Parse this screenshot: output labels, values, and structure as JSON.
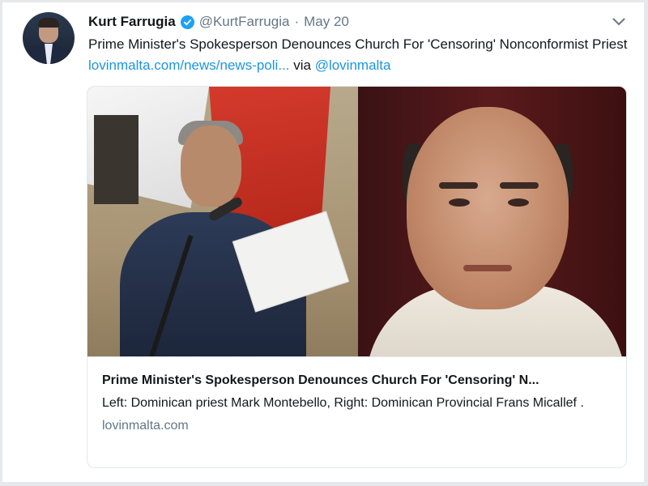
{
  "tweet": {
    "author_name": "Kurt Farrugia",
    "handle": "@KurtFarrugia",
    "separator": "·",
    "date": "May 20",
    "text": "Prime Minister's Spokesperson Denounces Church For 'Censoring' Nonconformist Priest",
    "link_text": "lovinmalta.com/news/news-poli...",
    "via_text": "via",
    "via_handle": "@lovinmalta",
    "icons": {
      "verified": "verified-badge-icon",
      "menu": "chevron-down-icon"
    },
    "colors": {
      "link": "#1b95e0",
      "verified": "#1da1f2",
      "secondary_text": "#657786"
    }
  },
  "card": {
    "title": "Prime Minister's Spokesperson Denounces Church For 'Censoring' N...",
    "description": "Left: Dominican priest Mark Montebello, Right: Dominican Provincial Frans Micallef .",
    "domain": "lovinmalta.com"
  }
}
